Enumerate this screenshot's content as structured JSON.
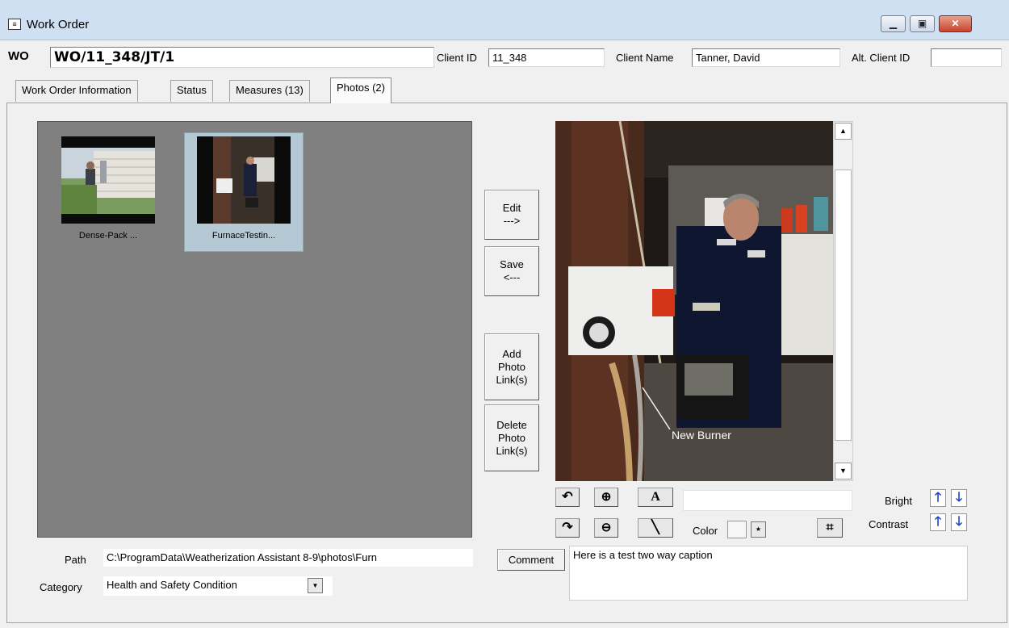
{
  "window": {
    "title": "Work Order",
    "icon": "form-icon",
    "controls": {
      "minimize": "minimize-icon",
      "restore": "restore-icon",
      "close": "close-icon"
    }
  },
  "header": {
    "wo_label": "WO",
    "wo_value": "WO/11_348/JT/1",
    "client_id_label": "Client ID",
    "client_id_value": "11_348",
    "client_name_label": "Client Name",
    "client_name_value": "Tanner, David",
    "alt_client_id_label": "Alt. Client ID",
    "alt_client_id_value": ""
  },
  "tabs": [
    {
      "label": "Work Order Information",
      "active": false
    },
    {
      "label": "Status",
      "active": false
    },
    {
      "label": "Measures (13)",
      "active": false
    },
    {
      "label": "Photos (2)",
      "active": true
    }
  ],
  "gallery": {
    "photos": [
      {
        "caption": "Dense-Pack ...",
        "selected": false
      },
      {
        "caption": "FurnaceTestin...",
        "selected": true
      }
    ]
  },
  "actions": {
    "edit": [
      "Edit",
      "--->"
    ],
    "save": [
      "Save",
      "<---"
    ],
    "add": [
      "Add",
      "Photo",
      "Link(s)"
    ],
    "delete": [
      "Delete",
      "Photo",
      "Link(s)"
    ]
  },
  "image_overlay": {
    "annotation": "New Burner"
  },
  "tools": {
    "color_label": "Color",
    "caption_text_value": "",
    "bright_label": "Bright",
    "contrast_label": "Contrast",
    "accent_color": "#1a3fc4"
  },
  "footer": {
    "path_label": "Path",
    "path_value": "C:\\ProgramData\\Weatherization Assistant 8-9\\photos\\Furn",
    "category_label": "Category",
    "category_value": "Health and Safety Condition",
    "comment_button": "Comment",
    "comment_value": "Here is a test two way caption"
  }
}
